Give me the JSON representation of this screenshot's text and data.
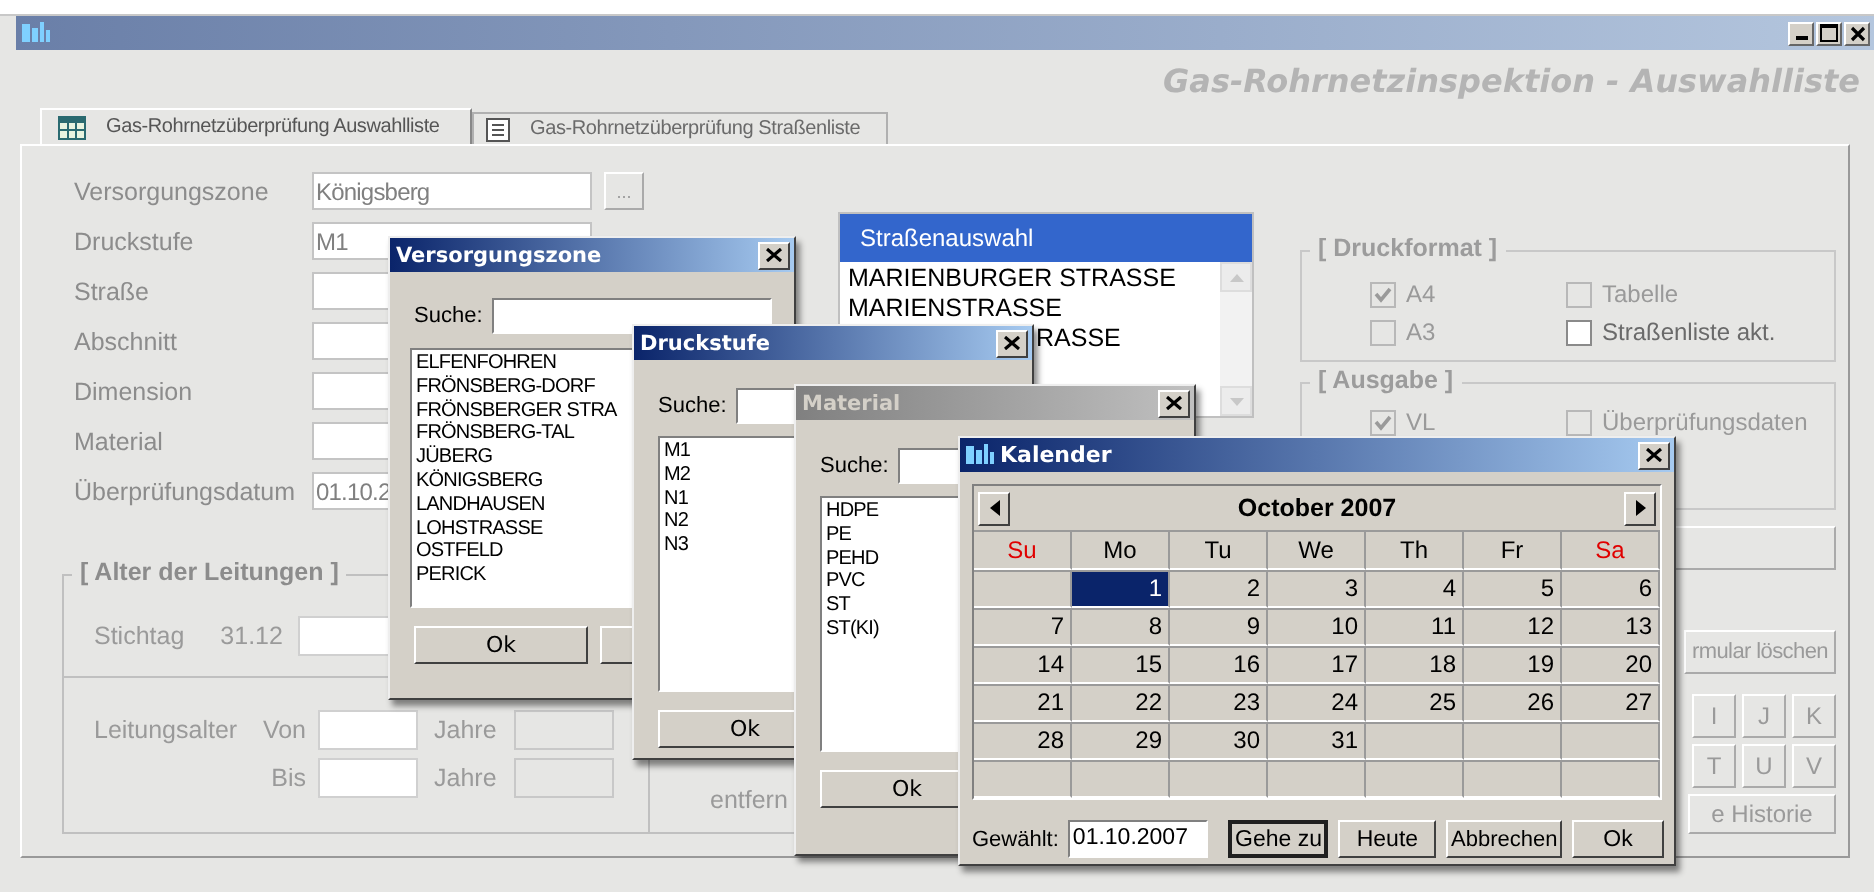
{
  "window": {
    "heading": "Gas-Rohrnetzinspektion - Auswahlliste"
  },
  "tabs": [
    {
      "label": "Gas-Rohrnetzüberprüfung Auswahlliste",
      "selected": true,
      "kind": "table"
    },
    {
      "label": "Gas-Rohrnetzüberprüfung Straßenliste",
      "selected": false,
      "kind": "list"
    }
  ],
  "form": {
    "fields": [
      {
        "label": "Versorgungszone",
        "value": "Königsberg",
        "browse": "..."
      },
      {
        "label": "Druckstufe",
        "value": "M1"
      },
      {
        "label": "Straße"
      },
      {
        "label": "Abschnitt"
      },
      {
        "label": "Dimension"
      },
      {
        "label": "Material"
      },
      {
        "label": "Überprüfungsdatum",
        "value": "01.10.2"
      }
    ]
  },
  "age_group": {
    "title": "[ Alter der Leitungen ]",
    "stichtag_label": "Stichtag",
    "stichtag_prefix": "31.12",
    "age_label": "Leitungsalter",
    "from_label": "Von",
    "to_label": "Bis",
    "unit_labels": [
      "Jahre",
      "Jahre"
    ],
    "side_text": "entfern"
  },
  "street_list": {
    "title": "Straßenauswahl",
    "items": [
      {
        "text": "MARIENBURGER STRASSE",
        "clipped": false
      },
      {
        "text": "MARIENSTRASSE",
        "clipped": false
      },
      {
        "text": "RASSE",
        "clipped": true
      }
    ]
  },
  "print_format": {
    "title": "[ Druckformat ]",
    "options": [
      {
        "label": "A4",
        "checked": true,
        "disabled": true
      },
      {
        "label": "Tabelle",
        "checked": false,
        "disabled": true
      },
      {
        "label": "A3",
        "checked": false,
        "disabled": true
      },
      {
        "label": "Straßenliste akt.",
        "checked": false,
        "disabled": false
      }
    ]
  },
  "output": {
    "title": "[ Ausgabe ]",
    "options": [
      {
        "label": "VL",
        "checked": true,
        "disabled": true
      },
      {
        "label": "Überprüfungsdaten",
        "checked": false,
        "disabled": true
      }
    ]
  },
  "right_buttons": {
    "clear": "rmular löschen",
    "letters": [
      "I",
      "J",
      "K",
      "T",
      "U",
      "V"
    ],
    "history": "e Historie"
  },
  "dialogs": [
    {
      "title": "Versorgungszone",
      "active": true,
      "search_label": "Suche:",
      "items": [
        "ELFENFOHREN",
        "FRÖNSBERG-DORF",
        "FRÖNSBERGER STRA",
        "FRÖNSBERG-TAL",
        "JÜBERG",
        "KÖNIGSBERG",
        "LANDHAUSEN",
        "LOHSTRASSE",
        "OSTFELD",
        "PERICK"
      ],
      "ok": "Ok"
    },
    {
      "title": "Druckstufe",
      "active": true,
      "search_label": "Suche:",
      "items": [
        "M1",
        "M2",
        "N1",
        "N2",
        "N3"
      ],
      "ok": "Ok"
    },
    {
      "title": "Material",
      "active": false,
      "search_label": "Suche:",
      "items": [
        "HDPE",
        "PE",
        "PEHD",
        "PVC",
        "ST",
        "ST(KI)"
      ],
      "ok": "Ok"
    }
  ],
  "calendar": {
    "title": "Kalender",
    "month": "October 2007",
    "weekdays": [
      {
        "label": "Su",
        "weekend": true
      },
      {
        "label": "Mo",
        "weekend": false
      },
      {
        "label": "Tu",
        "weekend": false
      },
      {
        "label": "We",
        "weekend": false
      },
      {
        "label": "Th",
        "weekend": false
      },
      {
        "label": "Fr",
        "weekend": false
      },
      {
        "label": "Sa",
        "weekend": true
      }
    ],
    "weeks": [
      [
        {
          "selected": false
        },
        {
          "day": "1",
          "selected": true
        },
        {
          "day": "2",
          "selected": false
        },
        {
          "day": "3",
          "selected": false
        },
        {
          "day": "4",
          "selected": false
        },
        {
          "day": "5",
          "selected": false
        },
        {
          "day": "6",
          "selected": false
        }
      ],
      [
        {
          "day": "7",
          "selected": false
        },
        {
          "day": "8",
          "selected": false
        },
        {
          "day": "9",
          "selected": false
        },
        {
          "day": "10",
          "selected": false
        },
        {
          "day": "11",
          "selected": false
        },
        {
          "day": "12",
          "selected": false
        },
        {
          "day": "13",
          "selected": false
        }
      ],
      [
        {
          "day": "14",
          "selected": false
        },
        {
          "day": "15",
          "selected": false
        },
        {
          "day": "16",
          "selected": false
        },
        {
          "day": "17",
          "selected": false
        },
        {
          "day": "18",
          "selected": false
        },
        {
          "day": "19",
          "selected": false
        },
        {
          "day": "20",
          "selected": false
        }
      ],
      [
        {
          "day": "21",
          "selected": false
        },
        {
          "day": "22",
          "selected": false
        },
        {
          "day": "23",
          "selected": false
        },
        {
          "day": "24",
          "selected": false
        },
        {
          "day": "25",
          "selected": false
        },
        {
          "day": "26",
          "selected": false
        },
        {
          "day": "27",
          "selected": false
        }
      ],
      [
        {
          "day": "28",
          "selected": false
        },
        {
          "day": "29",
          "selected": false
        },
        {
          "day": "30",
          "selected": false
        },
        {
          "day": "31",
          "selected": false
        },
        {
          "selected": false
        },
        {
          "selected": false
        },
        {
          "selected": false
        }
      ],
      [
        {
          "selected": false
        },
        {
          "selected": false
        },
        {
          "selected": false
        },
        {
          "selected": false
        },
        {
          "selected": false
        },
        {
          "selected": false
        },
        {
          "selected": false
        }
      ]
    ],
    "chosen_label": "Gewählt:",
    "chosen_value": "01.10.2007",
    "buttons": [
      {
        "label": "Gehe zu",
        "default": true
      },
      {
        "label": "Heute",
        "default": false
      },
      {
        "label": "Abbrechen",
        "default": false
      },
      {
        "label": "Ok",
        "default": false
      }
    ]
  }
}
